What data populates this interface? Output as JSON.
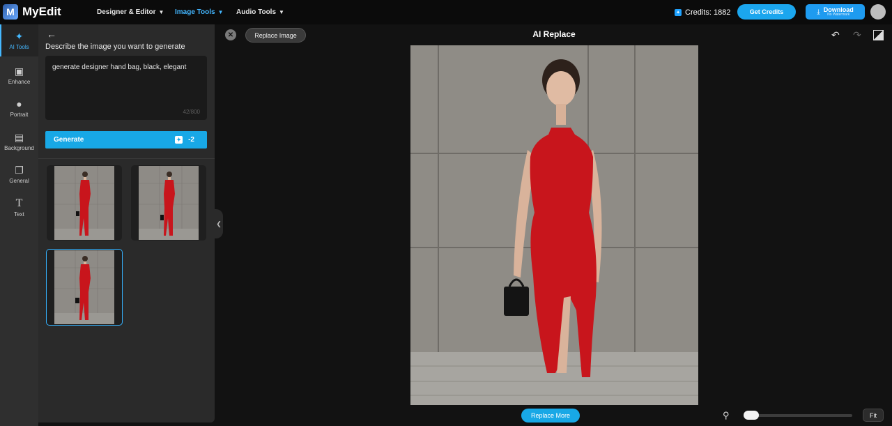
{
  "app": {
    "name": "MyEdit"
  },
  "nav": [
    {
      "label": "Designer & Editor",
      "active": false
    },
    {
      "label": "Image Tools",
      "active": true
    },
    {
      "label": "Audio Tools",
      "active": false
    }
  ],
  "header": {
    "credits_label": "Credits: 1882",
    "get_credits": "Get Credits",
    "download_main": "Download",
    "download_sub": "No Watermark"
  },
  "rail": [
    {
      "label": "AI Tools",
      "icon": "magic-wand-icon",
      "active": true
    },
    {
      "label": "Enhance",
      "icon": "image-enhance-icon",
      "active": false
    },
    {
      "label": "Portrait",
      "icon": "portrait-icon",
      "active": false
    },
    {
      "label": "Background",
      "icon": "background-icon",
      "active": false
    },
    {
      "label": "General",
      "icon": "layers-icon",
      "active": false
    },
    {
      "label": "Text",
      "icon": "text-icon",
      "active": false
    }
  ],
  "panel": {
    "title": "Describe the image you want to generate",
    "prompt_value": "generate designer hand bag, black, elegant",
    "char_count": "42/800",
    "generate_label": "Generate",
    "generate_cost": "-2",
    "results": [
      {
        "selected": false
      },
      {
        "selected": false
      },
      {
        "selected": true
      }
    ]
  },
  "canvas": {
    "replace_image": "Replace Image",
    "title": "AI Replace",
    "replace_more": "Replace More",
    "fit": "Fit",
    "zoom_fraction": 0.05
  },
  "colors": {
    "accent": "#18a8e6",
    "dress": "#c8151c",
    "wall": "#8f8c86"
  }
}
